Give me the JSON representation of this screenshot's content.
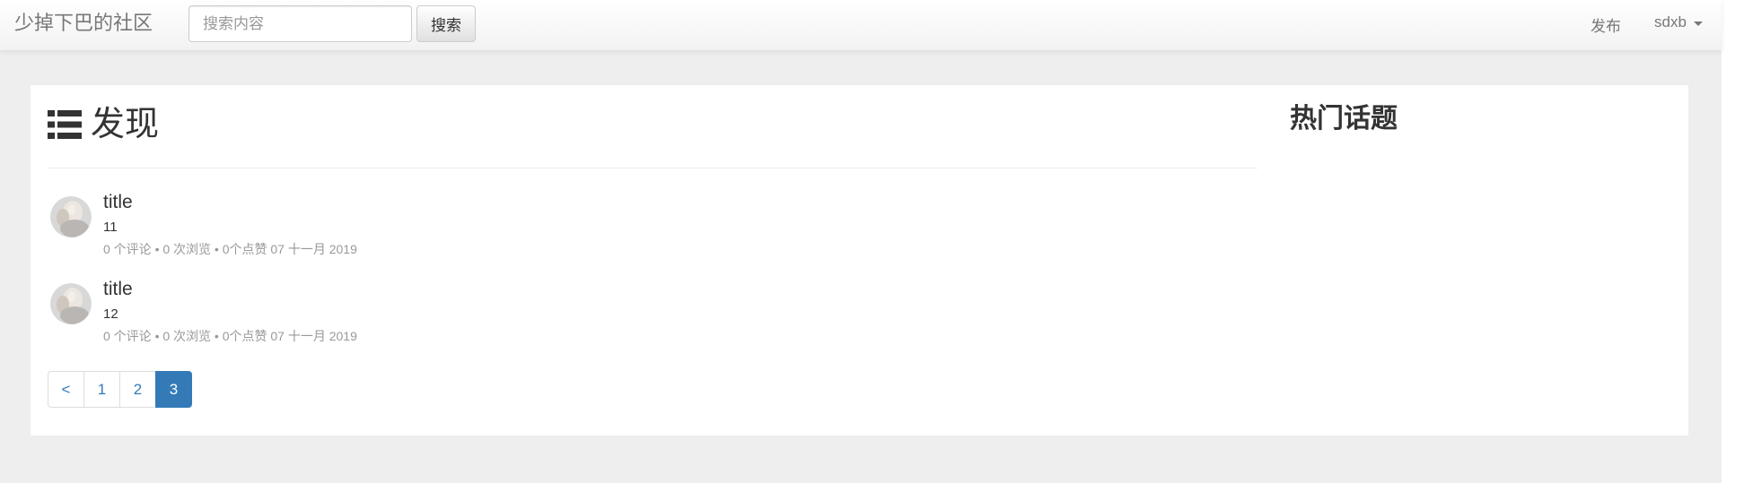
{
  "navbar": {
    "brand": "少掉下巴的社区",
    "search_placeholder": "搜索内容",
    "search_button": "搜索",
    "publish_link": "发布",
    "user_menu": "sdxb"
  },
  "main": {
    "title": "发现",
    "title_icon": "list-icon"
  },
  "sidebar": {
    "title": "热门话题"
  },
  "posts": [
    {
      "title": "title",
      "description": "11",
      "meta": "0 个评论 • 0 次浏览 • 0个点赞 07 十一月 2019"
    },
    {
      "title": "title",
      "description": "12",
      "meta": "0 个评论 • 0 次浏览 • 0个点赞 07 十一月 2019"
    }
  ],
  "pagination": {
    "prev": "<",
    "pages": [
      "1",
      "2",
      "3"
    ],
    "active": "3"
  },
  "colors": {
    "accent": "#337ab7",
    "background": "#eeeeee",
    "muted_text": "#999999"
  }
}
